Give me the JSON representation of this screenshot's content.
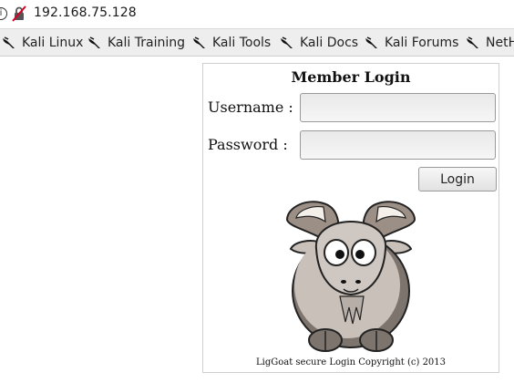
{
  "address_bar": {
    "url": "192.168.75.128",
    "info_icon": "info-icon",
    "security_icon": "insecure-lock-icon"
  },
  "bookmarks": [
    {
      "label": "Kali Linux",
      "icon": "kali-dragon-icon"
    },
    {
      "label": "Kali Training",
      "icon": "kali-dragon-icon"
    },
    {
      "label": "Kali Tools",
      "icon": "kali-dragon-icon"
    },
    {
      "label": "Kali Docs",
      "icon": "kali-dragon-icon"
    },
    {
      "label": "Kali Forums",
      "icon": "kali-dragon-icon"
    },
    {
      "label": "NetH",
      "icon": "kali-dragon-icon"
    }
  ],
  "login": {
    "title": "Member Login",
    "username_label": "Username :",
    "username_value": "",
    "password_label": "Password  :",
    "password_value": "",
    "submit_label": "Login",
    "image": "goat-logo",
    "footer": "LigGoat secure Login Copyright (c) 2013"
  }
}
